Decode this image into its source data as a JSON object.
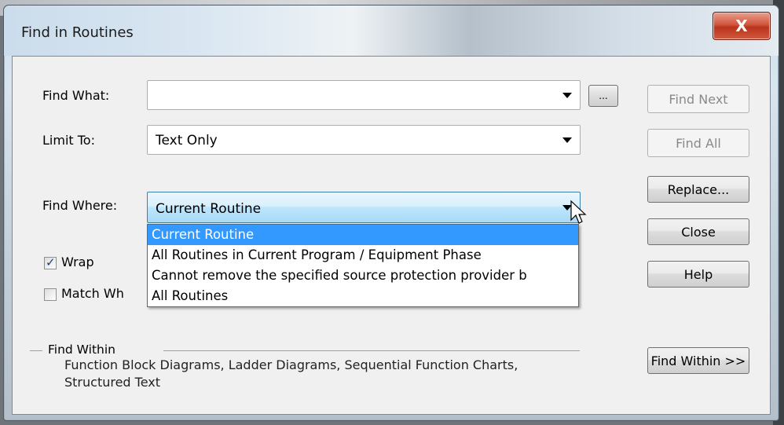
{
  "window": {
    "title": "Find in Routines",
    "close_glyph": "X"
  },
  "find_what": {
    "label": "Find What:",
    "value": "",
    "browse_label": "..."
  },
  "limit_to": {
    "label": "Limit To:",
    "value": "Text Only"
  },
  "find_where": {
    "label": "Find Where:",
    "value": "Current Routine",
    "options": [
      "Current Routine",
      "All Routines in Current Program / Equipment Phase",
      "Cannot remove the specified source protection provider b",
      "All Routines"
    ]
  },
  "options": {
    "wrap_label": "Wrap",
    "wrap_checked": true,
    "match_whole_label": "Match Wh",
    "match_whole_checked": false
  },
  "buttons": {
    "find_next": "Find Next",
    "find_all": "Find All",
    "replace": "Replace...",
    "close": "Close",
    "help": "Help",
    "find_within": "Find Within >>"
  },
  "find_within": {
    "label": "Find Within",
    "text": "Function Block Diagrams, Ladder Diagrams, Sequential Function Charts, Structured Text"
  },
  "colors": {
    "selection": "#3399ff",
    "close_button": "#c74a30"
  }
}
